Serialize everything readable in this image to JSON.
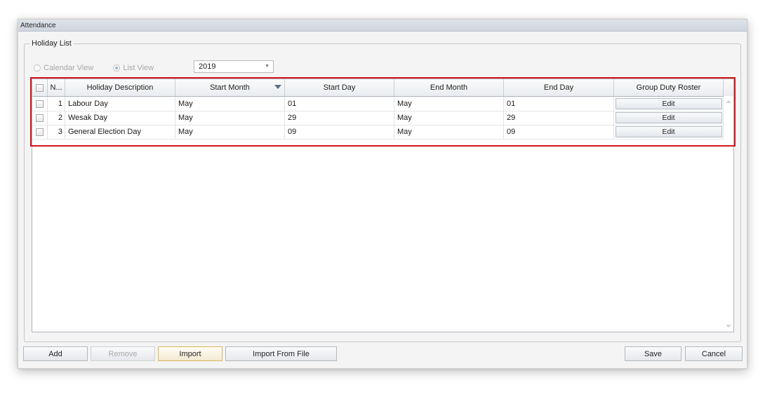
{
  "window": {
    "title": "Attendance"
  },
  "group": {
    "label": "Holiday List"
  },
  "view_options": [
    {
      "label": "Calendar View",
      "checked": false
    },
    {
      "label": "List View",
      "checked": true
    }
  ],
  "year_select": {
    "value": "2019"
  },
  "grid": {
    "columns": {
      "no": "N...",
      "description": "Holiday Description",
      "start_month": "Start Month",
      "start_day": "Start Day",
      "end_month": "End Month",
      "end_day": "End Day",
      "roster": "Group Duty Roster"
    },
    "rows": [
      {
        "no": "1",
        "description": "Labour Day",
        "start_month": "May",
        "start_day": "01",
        "end_month": "May",
        "end_day": "01",
        "action": "Edit"
      },
      {
        "no": "2",
        "description": "Wesak Day",
        "start_month": "May",
        "start_day": "29",
        "end_month": "May",
        "end_day": "29",
        "action": "Edit"
      },
      {
        "no": "3",
        "description": "General Election Day",
        "start_month": "May",
        "start_day": "09",
        "end_month": "May",
        "end_day": "09",
        "action": "Edit"
      }
    ]
  },
  "buttons": {
    "add": "Add",
    "remove": "Remove",
    "import": "Import",
    "import_from_file": "Import From File",
    "save": "Save",
    "cancel": "Cancel"
  },
  "colors": {
    "highlight_border": "#d8141c",
    "titlebar": "#d5dbe3"
  }
}
